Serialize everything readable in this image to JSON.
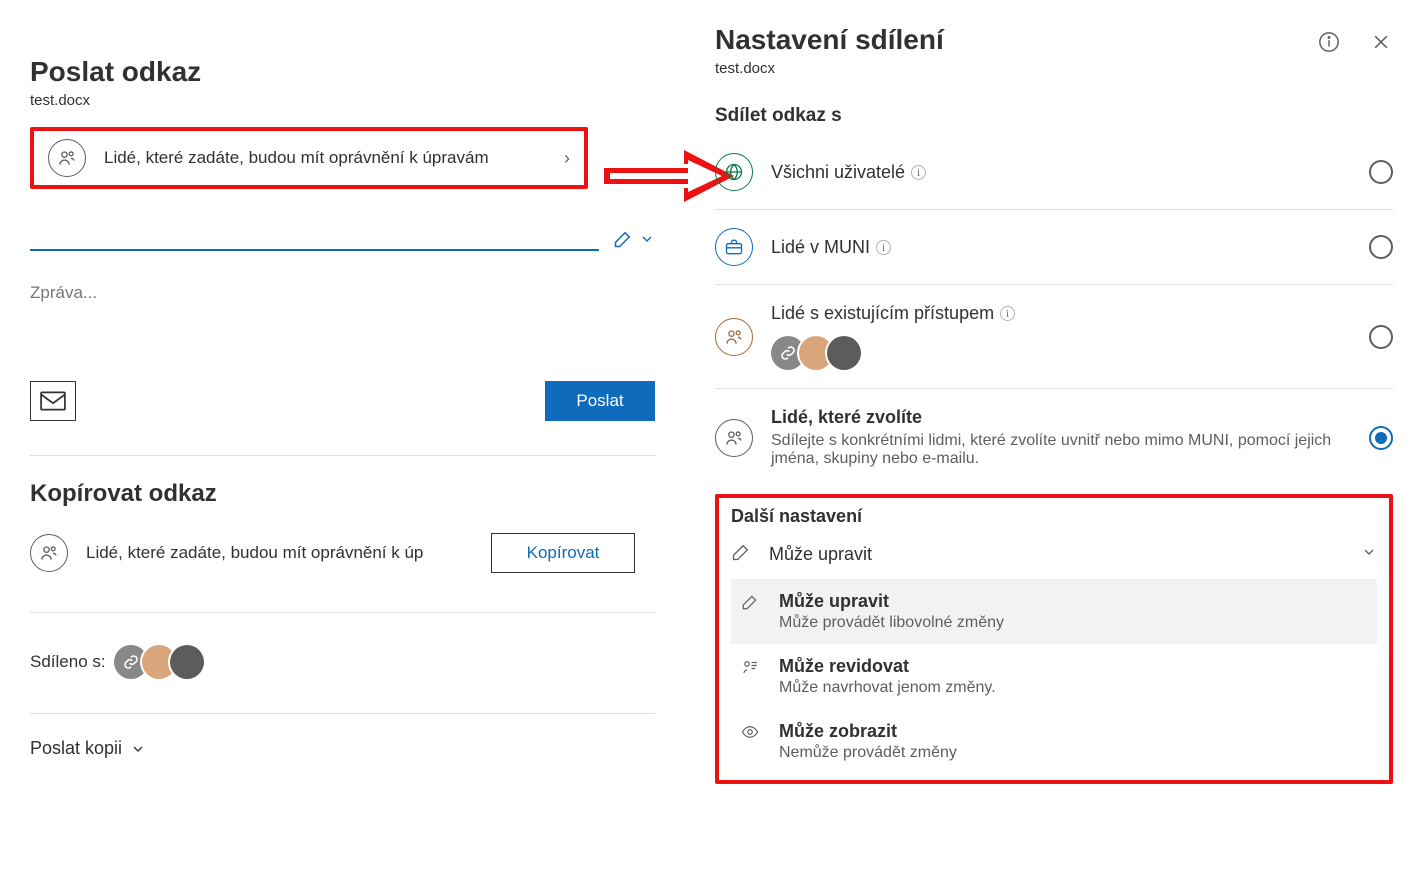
{
  "left": {
    "title": "Poslat odkaz",
    "filename": "test.docx",
    "perm_summary": "Lidé, které zadáte, budou mít oprávnění k úpravám",
    "message_placeholder": "Zpráva...",
    "send_label": "Poslat",
    "copy_title": "Kopírovat odkaz",
    "copy_summary": "Lidé, které zadáte, budou mít oprávnění k úp",
    "copy_label": "Kopírovat",
    "shared_label": "Sdíleno s:",
    "send_copy_label": "Poslat kopii"
  },
  "right": {
    "title": "Nastavení sdílení",
    "filename": "test.docx",
    "share_with_label": "Sdílet odkaz s",
    "options": {
      "anyone": "Všichni uživatelé",
      "org": "Lidé v MUNI",
      "existing": "Lidé s existujícím přístupem",
      "specific": "Lidé, které zvolíte",
      "specific_sub": "Sdílejte s konkrétními lidmi, které zvolíte uvnitř nebo mimo MUNI, pomocí jejich jména, skupiny nebo e-mailu."
    },
    "more_label": "Další nastavení",
    "selected_perm": "Může upravit",
    "perms": {
      "edit_t": "Může upravit",
      "edit_s": "Může provádět libovolné změny",
      "review_t": "Může revidovat",
      "review_s": "Může navrhovat jenom změny.",
      "view_t": "Může zobrazit",
      "view_s": "Nemůže provádět změny"
    }
  }
}
